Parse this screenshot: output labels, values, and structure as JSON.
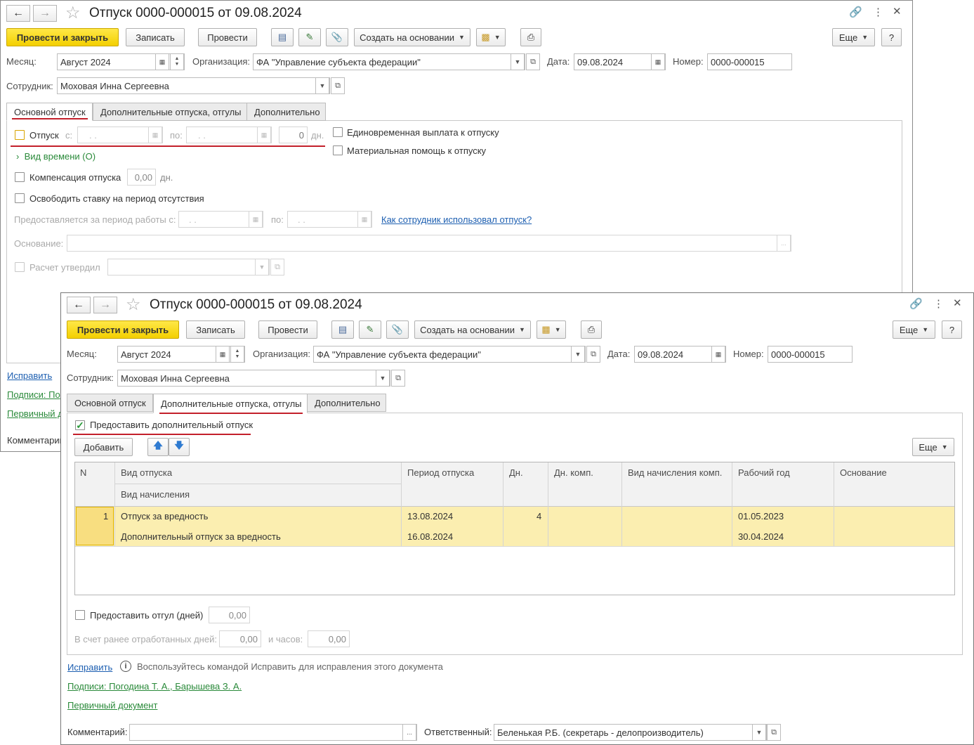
{
  "back": {
    "title": "Отпуск 0000-000015 от 09.08.2024",
    "toolbar": {
      "post_close": "Провести и закрыть",
      "write": "Записать",
      "post": "Провести",
      "create_based": "Создать на основании",
      "more": "Еще",
      "help": "?"
    },
    "fields": {
      "month_label": "Месяц:",
      "month_value": "Август 2024",
      "org_label": "Организация:",
      "org_value": "ФА \"Управление субъекта федерации\"",
      "date_label": "Дата:",
      "date_value": "09.08.2024",
      "number_label": "Номер:",
      "number_value": "0000-000015",
      "employee_label": "Сотрудник:",
      "employee_value": "Моховая Инна Сергеевна"
    },
    "tabs": [
      "Основной отпуск",
      "Дополнительные отпуска, отгулы",
      "Дополнительно"
    ],
    "main": {
      "vacation_label": "Отпуск",
      "from_label": "с:",
      "from_value": ". .",
      "to_label": "по:",
      "to_value": ". .",
      "days_value": "0",
      "days_unit": "дн.",
      "lump_sum": "Единовременная выплата к отпуску",
      "material_aid": "Материальная помощь к отпуску",
      "time_type": "Вид времени (О)",
      "compensation_label": "Компенсация отпуска",
      "compensation_value": "0,00",
      "compensation_unit": "дн.",
      "release_rate": "Освободить ставку на период отсутствия",
      "period_label": "Предоставляется за период работы с:",
      "period_from": ". .",
      "period_to_label": "по:",
      "period_to": ". .",
      "how_used_link": "Как сотрудник использовал отпуск?",
      "basis_label": "Основание:",
      "basis_btn": "...",
      "approved_label": "Расчет утвердил"
    },
    "footer": {
      "correct": "Исправить",
      "signatures": "Подписи: По",
      "primary": "Первичный д",
      "comment": "Комментарий"
    }
  },
  "front": {
    "title": "Отпуск 0000-000015 от 09.08.2024",
    "toolbar": {
      "post_close": "Провести и закрыть",
      "write": "Записать",
      "post": "Провести",
      "create_based": "Создать на основании",
      "more": "Еще",
      "help": "?"
    },
    "fields": {
      "month_label": "Месяц:",
      "month_value": "Август 2024",
      "org_label": "Организация:",
      "org_value": "ФА \"Управление субъекта федерации\"",
      "date_label": "Дата:",
      "date_value": "09.08.2024",
      "number_label": "Номер:",
      "number_value": "0000-000015",
      "employee_label": "Сотрудник:",
      "employee_value": "Моховая Инна Сергеевна"
    },
    "tabs": [
      "Основной отпуск",
      "Дополнительные отпуска, отгулы",
      "Дополнительно"
    ],
    "extra": {
      "grant_additional": "Предоставить дополнительный отпуск",
      "add_button": "Добавить",
      "more": "Еще",
      "columns": {
        "n": "N",
        "vacation_type": "Вид отпуска",
        "accrual_type": "Вид начисления",
        "period": "Период отпуска",
        "days": "Дн.",
        "comp_days": "Дн. комп.",
        "comp_accrual": "Вид начисления комп.",
        "work_year": "Рабочий год",
        "basis": "Основание"
      },
      "rows": [
        {
          "n": "1",
          "vacation_type": "Отпуск за вредность",
          "accrual_type": "Дополнительный отпуск за вредность",
          "period_start": "13.08.2024",
          "period_end": "16.08.2024",
          "days": "4",
          "comp_days": "",
          "comp_accrual": "",
          "work_year_start": "01.05.2023",
          "work_year_end": "30.04.2024",
          "basis": ""
        }
      ],
      "time_off_label": "Предоставить отгул (дней)",
      "time_off_value": "0,00",
      "worked_days_label": "В счет ранее отработанных дней:",
      "worked_days_value": "0,00",
      "hours_label": "и часов:",
      "hours_value": "0,00"
    },
    "footer": {
      "correct": "Исправить",
      "correct_hint": "Воспользуйтесь командой Исправить для исправления этого документа",
      "signatures": "Подписи: Погодина Т. А., Барышева З. А.",
      "primary": "Первичный документ",
      "comment_label": "Комментарий:",
      "comment_value": "",
      "comment_btn": "...",
      "responsible_label": "Ответственный:",
      "responsible_value": "Беленькая Р.Б. (секретарь - делопроизводитель)"
    }
  },
  "icons": {
    "back": "arrow-left-icon",
    "forward": "arrow-right-icon",
    "favorite": "star-icon",
    "link": "link-icon",
    "menu": "kebab-icon",
    "close": "close-icon",
    "report": "document-icon",
    "edit": "pen-icon",
    "attach": "paperclip-icon",
    "print": "printer-icon",
    "calendar": "calendar-icon",
    "dropdown": "chevron-down-icon",
    "open": "open-icon",
    "info": "info-icon",
    "up": "arrow-up-icon",
    "down": "arrow-down-icon"
  },
  "colors": {
    "primary_button": "#f3cf00",
    "highlight_row": "#fbeeb0",
    "link": "#1d5fb1",
    "green_link": "#2a8a3a",
    "annotation": "#c3202b"
  }
}
